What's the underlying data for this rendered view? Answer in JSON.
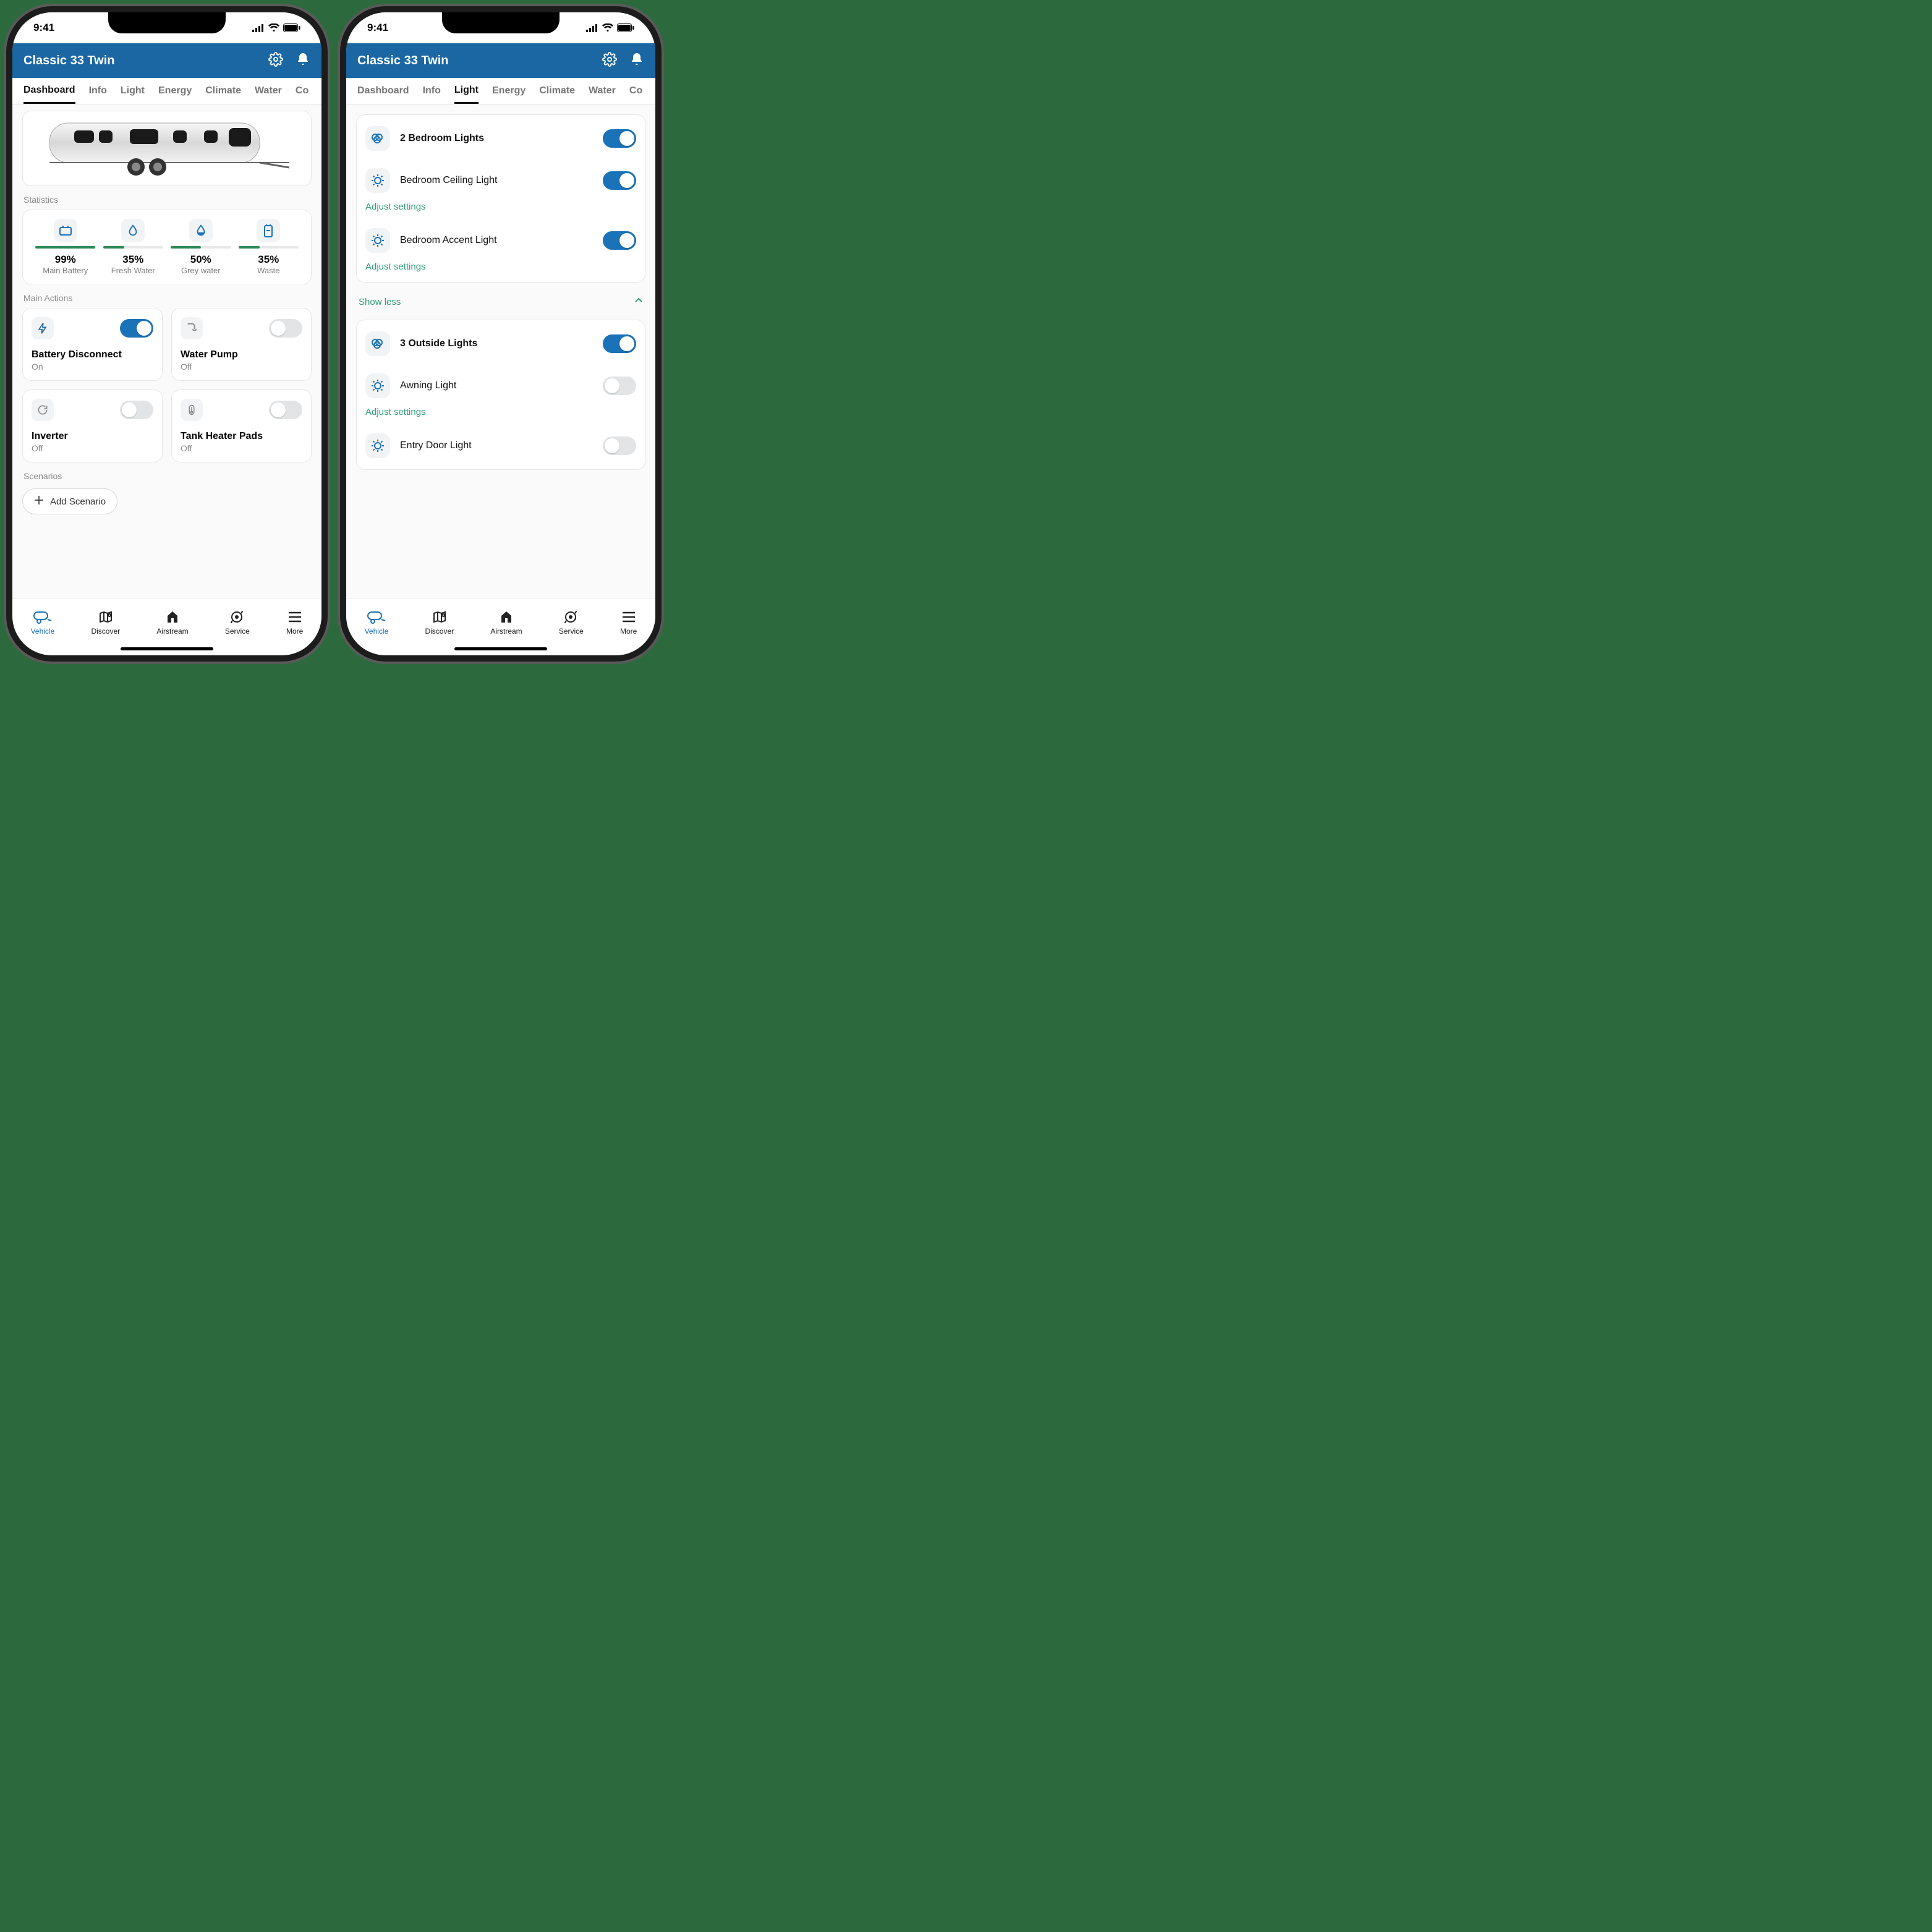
{
  "status_bar": {
    "time": "9:41"
  },
  "header": {
    "title": "Classic 33 Twin"
  },
  "tabs": [
    "Dashboard",
    "Info",
    "Light",
    "Energy",
    "Climate",
    "Water",
    "Co"
  ],
  "phone1": {
    "active_tab": "Dashboard"
  },
  "phone2": {
    "active_tab": "Light"
  },
  "sections": {
    "statistics": "Statistics",
    "main_actions": "Main Actions",
    "scenarios": "Scenarios"
  },
  "stats": [
    {
      "name": "Main Battery",
      "value": "99%",
      "fill": 99
    },
    {
      "name": "Fresh Water",
      "value": "35%",
      "fill": 35
    },
    {
      "name": "Grey water",
      "value": "50%",
      "fill": 50
    },
    {
      "name": "Waste",
      "value": "35%",
      "fill": 35
    }
  ],
  "actions": [
    {
      "title": "Battery Disconnect",
      "state": "On",
      "on": true
    },
    {
      "title": "Water Pump",
      "state": "Off",
      "on": false
    },
    {
      "title": "Inverter",
      "state": "Off",
      "on": false
    },
    {
      "title": "Tank Heater Pads",
      "state": "Off",
      "on": false
    }
  ],
  "scenario_button": "Add Scenario",
  "lights_group1": {
    "header": "2 Bedroom Lights",
    "header_on": true,
    "items": [
      {
        "name": "Bedroom Ceiling Light",
        "on": true,
        "adjust": true
      },
      {
        "name": "Bedroom Accent Light",
        "on": true,
        "adjust": true
      }
    ],
    "collapse_label": "Show less",
    "adjust_label": "Adjust settings"
  },
  "lights_group2": {
    "header": "3 Outside Lights",
    "header_on": true,
    "items": [
      {
        "name": "Awning Light",
        "on": false,
        "adjust": true
      },
      {
        "name": "Entry Door Light",
        "on": false,
        "adjust": false
      }
    ],
    "adjust_label": "Adjust settings"
  },
  "bottom_nav": [
    {
      "label": "Vehicle",
      "active": true
    },
    {
      "label": "Discover",
      "active": false
    },
    {
      "label": "Airstream",
      "active": false
    },
    {
      "label": "Service",
      "active": false
    },
    {
      "label": "More",
      "active": false
    }
  ]
}
